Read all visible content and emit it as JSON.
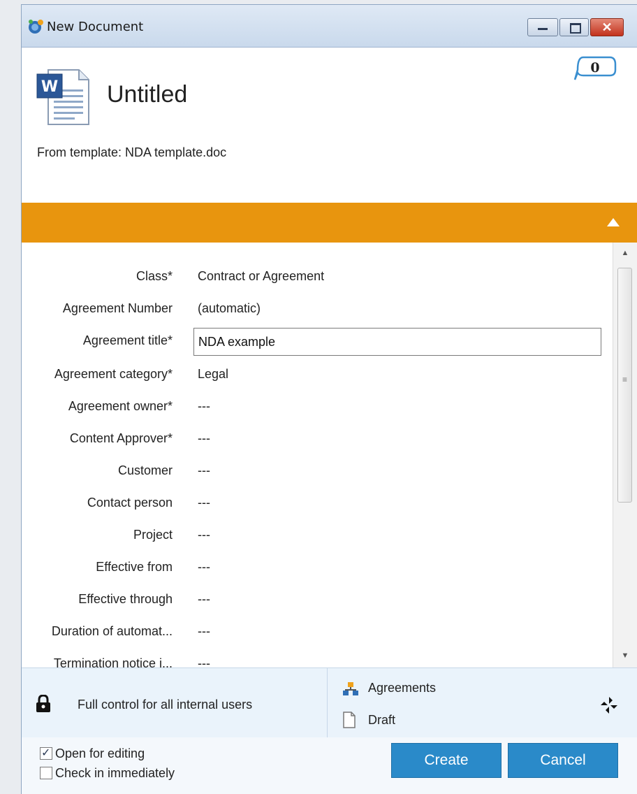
{
  "window": {
    "title": "New Document",
    "controls": {
      "minimize": "minimize",
      "maximize": "maximize",
      "close": "close"
    }
  },
  "header": {
    "document_title": "Untitled",
    "template_line": "From template: NDA template.doc",
    "comment_count": "0"
  },
  "properties": [
    {
      "label": "Class*",
      "value": "Contract or Agreement",
      "editable": false
    },
    {
      "label": "Agreement Number",
      "value": "(automatic)",
      "editable": false
    },
    {
      "label": "Agreement title*",
      "value": "NDA example",
      "editable": true
    },
    {
      "label": "Agreement category*",
      "value": "Legal",
      "editable": false
    },
    {
      "label": "Agreement owner*",
      "value": "---",
      "editable": false
    },
    {
      "label": "Content Approver*",
      "value": "---",
      "editable": false
    },
    {
      "label": "Customer",
      "value": "---",
      "editable": false
    },
    {
      "label": "Contact person",
      "value": "---",
      "editable": false
    },
    {
      "label": "Project",
      "value": "---",
      "editable": false
    },
    {
      "label": "Effective from",
      "value": "---",
      "editable": false
    },
    {
      "label": "Effective through",
      "value": "---",
      "editable": false
    },
    {
      "label": "Duration of automat...",
      "value": "---",
      "editable": false
    },
    {
      "label": "Termination notice i...",
      "value": "---",
      "editable": false
    }
  ],
  "info": {
    "permissions": "Full control for all internal users",
    "workflow": "Agreements",
    "state": "Draft"
  },
  "footer": {
    "open_for_editing": "Open for editing",
    "open_for_editing_checked": true,
    "check_in_immediately": "Check in immediately",
    "check_in_immediately_checked": false,
    "create_label": "Create",
    "cancel_label": "Cancel"
  },
  "colors": {
    "accent_orange": "#e8950e",
    "button_blue": "#2a8ac9",
    "info_panel_bg": "#eaf3fb"
  }
}
